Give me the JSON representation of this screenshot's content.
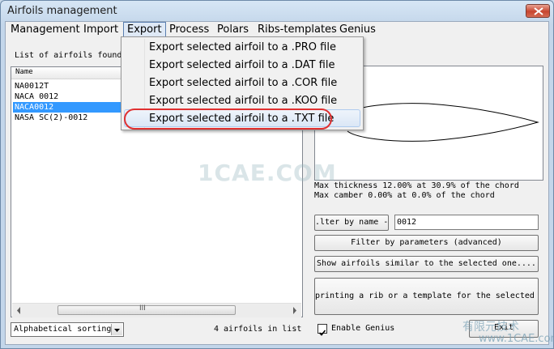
{
  "window": {
    "title": "Airfoils management"
  },
  "menubar": {
    "items": [
      "Management",
      "Import",
      "Export",
      "Process",
      "Polars",
      "Ribs-templates",
      "Genius"
    ]
  },
  "export_menu": {
    "items": [
      "Export selected airfoil to a .PRO file",
      "Export selected airfoil to a .DAT file",
      "Export selected airfoil to a .COR file",
      "Export selected airfoil to a .KOO file",
      "Export selected airfoil to a .TXT file"
    ]
  },
  "list": {
    "label": "List of airfoils found",
    "header": "Name",
    "rows": [
      "NA0012T",
      "NACA 0012",
      "NACA0012",
      "NASA SC(2)-0012"
    ],
    "selected_index": 2,
    "scroll_grip": "III"
  },
  "info": {
    "thickness": "Max thickness 12.00% at 30.9% of the chord",
    "camber": "Max camber  0.00% at 0.0% of the chord"
  },
  "filter": {
    "by_name_button": ".lter by name -",
    "name_value": "0012",
    "by_params_button": "Filter by parameters (advanced)",
    "similar_button": "Show airfoils similar to the selected one....",
    "rib_button": "printing a rib or a template for the selected a"
  },
  "footer": {
    "sort_value": "Alphabetical sorting",
    "count": "4 airfoils in list",
    "genius_label": "Enable Genius",
    "genius_checked": true,
    "exit_button": "Exit"
  },
  "watermarks": {
    "center": "1CAE.COM",
    "corner_cn": "有限元技术",
    "corner_url": "www.1CAE.com"
  },
  "colors": {
    "selection": "#3399ff",
    "highlight_ring": "#e03030",
    "close_button": "#c7452f"
  }
}
